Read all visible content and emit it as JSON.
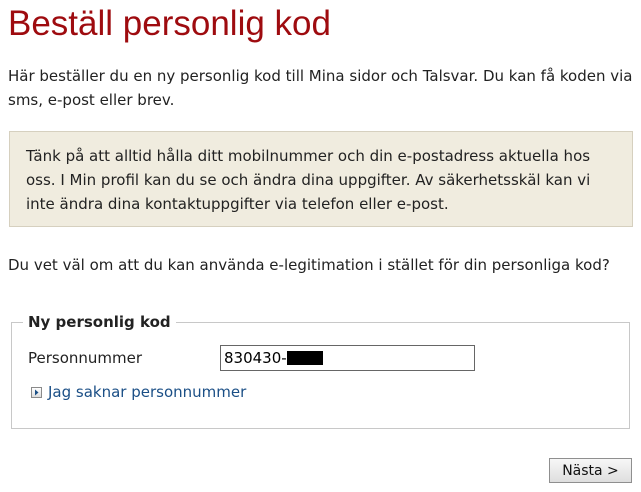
{
  "page": {
    "title": "Beställ personlig kod",
    "intro": "Här beställer du en ny personlig kod till Mina sidor och Talsvar. Du kan få koden via sms, e-post eller brev.",
    "notice": "Tänk på att alltid hålla ditt mobilnummer och din e-postadress aktuella hos oss. I Min profil kan du se och ändra dina uppgifter. Av säkerhetsskäl kan vi inte ändra dina kontaktuppgifter via telefon eller e-post.",
    "elegitimation": "Du vet väl om att du kan använda e-legitimation i stället för din personliga kod?"
  },
  "form": {
    "legend": "Ny personlig kod",
    "personnummer_label": "Personnummer",
    "personnummer_value": "830430-",
    "missing_link": "Jag saknar personnummer",
    "next_button": "Nästa >"
  },
  "icons": {
    "link": "arrow-right-icon"
  },
  "colors": {
    "title": "#9e0b0f",
    "notice_bg": "#f0ecdf",
    "link": "#1b4f86"
  }
}
